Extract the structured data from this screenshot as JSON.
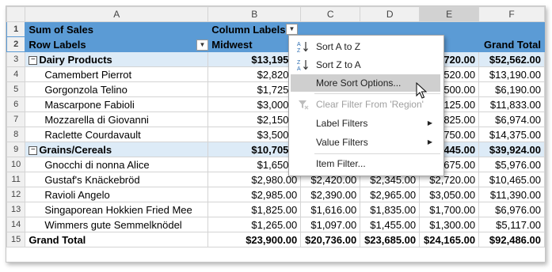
{
  "columns": [
    "A",
    "B",
    "C",
    "D",
    "E",
    "F"
  ],
  "header_rows": [
    {
      "num": "1",
      "a": "Sum of Sales",
      "b": "Column Labels",
      "c": "",
      "d": "",
      "e": "",
      "f": ""
    },
    {
      "num": "2",
      "a": "Row Labels",
      "b": "Midwest",
      "c": "",
      "d": "",
      "e": "",
      "f": "Grand Total"
    }
  ],
  "rows": [
    {
      "num": "3",
      "kind": "group",
      "a": "Dairy Products",
      "b": "$13,195.0",
      "c": "",
      "d": "",
      "e": "720.00",
      "f": "$52,562.00"
    },
    {
      "num": "4",
      "kind": "item",
      "a": "Camembert Pierrot",
      "b": "$2,820.0",
      "c": "",
      "d": "",
      "e": "520.00",
      "f": "$13,190.00"
    },
    {
      "num": "5",
      "kind": "item",
      "a": "Gorgonzola Telino",
      "b": "$1,725.0",
      "c": "",
      "d": "",
      "e": "500.00",
      "f": "$6,190.00"
    },
    {
      "num": "6",
      "kind": "item",
      "a": "Mascarpone Fabioli",
      "b": "$3,000.0",
      "c": "",
      "d": "",
      "e": "125.00",
      "f": "$11,833.00"
    },
    {
      "num": "7",
      "kind": "item",
      "a": "Mozzarella di Giovanni",
      "b": "$2,150.0",
      "c": "",
      "d": "",
      "e": "825.00",
      "f": "$6,974.00"
    },
    {
      "num": "8",
      "kind": "item",
      "a": "Raclette Courdavault",
      "b": "$3,500.0",
      "c": "",
      "d": "",
      "e": "750.00",
      "f": "$14,375.00"
    },
    {
      "num": "9",
      "kind": "group",
      "a": "Grains/Cereals",
      "b": "$10,705.0",
      "c": "",
      "d": "",
      "e": "445.00",
      "f": "$39,924.00"
    },
    {
      "num": "10",
      "kind": "item",
      "a": "Gnocchi di nonna Alice",
      "b": "$1,650.0",
      "c": "",
      "d": "",
      "e": "$1,675.00",
      "f": "$5,976.00"
    },
    {
      "num": "11",
      "kind": "item",
      "a": "Gustaf's Knäckebröd",
      "b": "$2,980.00",
      "c": "$2,420.00",
      "d": "$2,345.00",
      "e": "$2,720.00",
      "f": "$10,465.00"
    },
    {
      "num": "12",
      "kind": "item",
      "a": "Ravioli Angelo",
      "b": "$2,985.00",
      "c": "$2,390.00",
      "d": "$2,965.00",
      "e": "$3,050.00",
      "f": "$11,390.00"
    },
    {
      "num": "13",
      "kind": "item",
      "a": "Singaporean Hokkien Fried Mee",
      "b": "$1,825.00",
      "c": "$1,616.00",
      "d": "$1,835.00",
      "e": "$1,700.00",
      "f": "$6,976.00"
    },
    {
      "num": "14",
      "kind": "item",
      "a": "Wimmers gute Semmelknödel",
      "b": "$1,265.00",
      "c": "$1,097.00",
      "d": "$1,455.00",
      "e": "$1,300.00",
      "f": "$5,117.00"
    },
    {
      "num": "15",
      "kind": "total",
      "a": "Grand Total",
      "b": "$23,900.00",
      "c": "$20,736.00",
      "d": "$23,685.00",
      "e": "$24,165.00",
      "f": "$92,486.00"
    }
  ],
  "menu": {
    "sort_az": "Sort A to Z",
    "sort_za": "Sort Z to A",
    "more_sort": "More Sort Options...",
    "clear_filter": "Clear Filter From 'Region'",
    "label_filters": "Label Filters",
    "value_filters": "Value Filters",
    "item_filter": "Item Filter..."
  },
  "icons": {
    "dropdown": "chevron-down-icon",
    "submenu": "chevron-right-icon",
    "expand": "collapse-minus-icon"
  },
  "colors": {
    "header_bg": "#5b9bd5",
    "group_bg": "#ddebf7",
    "menu_hover": "#cfcfcf"
  }
}
